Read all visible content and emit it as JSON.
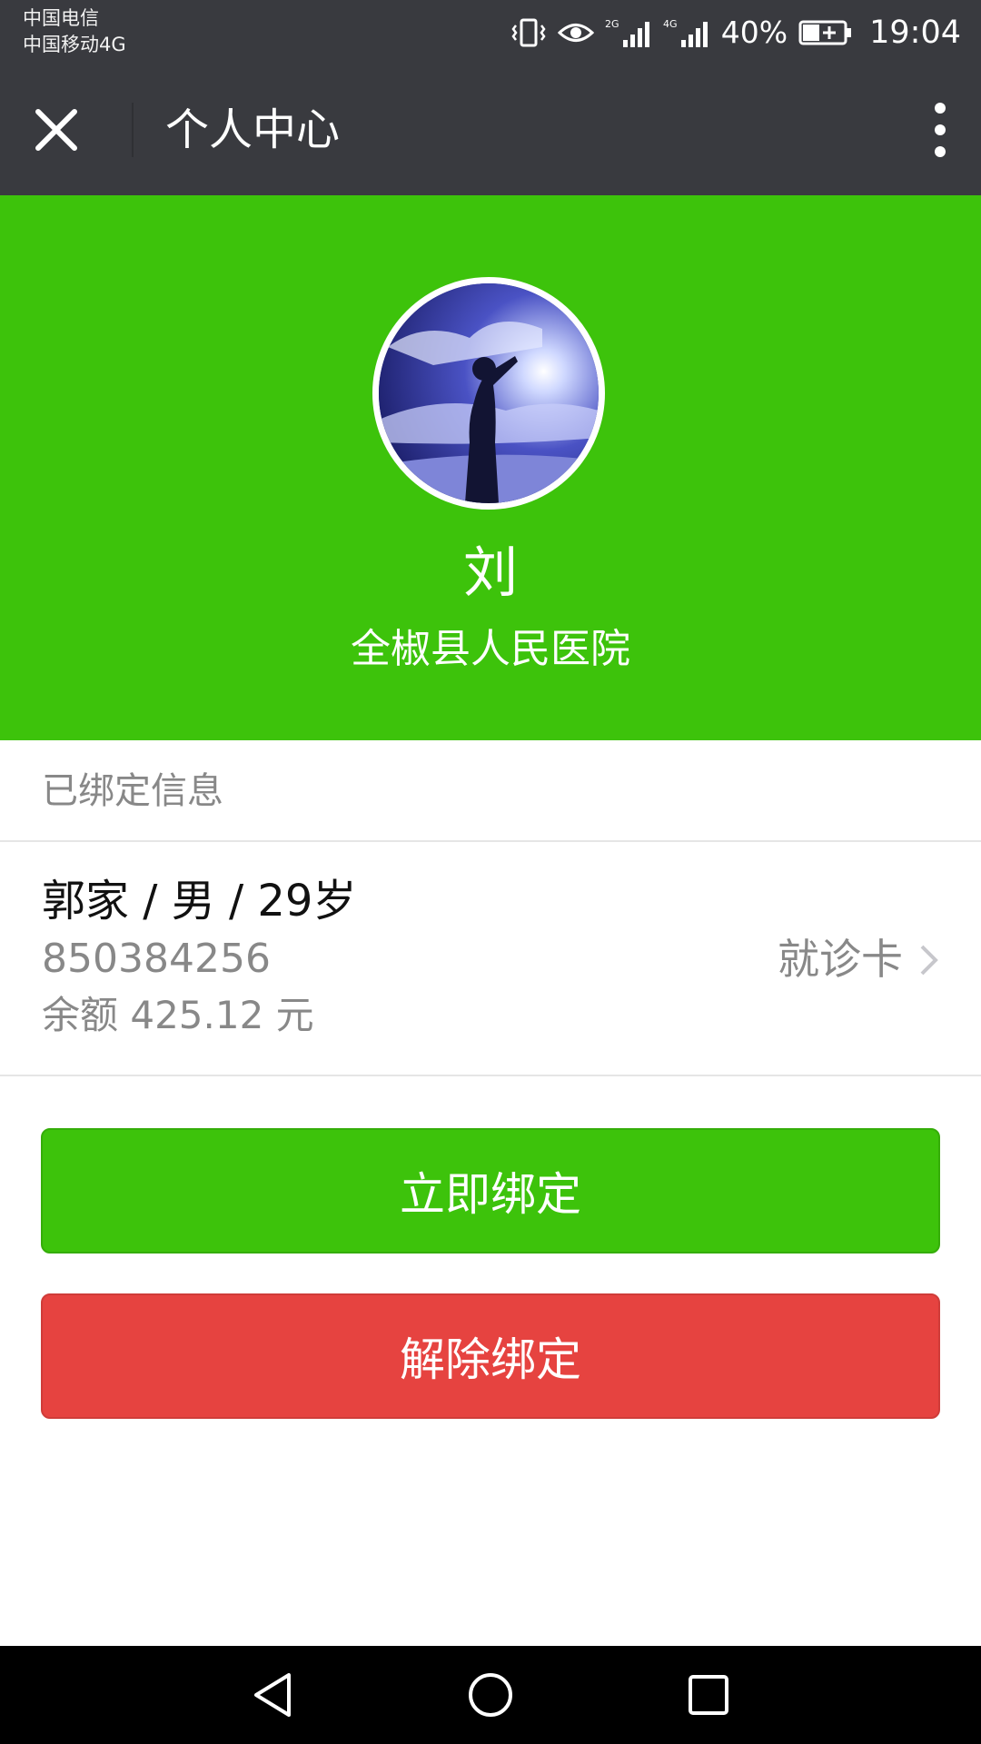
{
  "status_bar": {
    "carrier_1": "中国电信",
    "carrier_2": "中国移动4G",
    "signal_1_label": "2G",
    "signal_2_label": "4G",
    "battery": "40%",
    "time": "19:04"
  },
  "title_bar": {
    "title": "个人中心",
    "close_icon": "close-icon",
    "menu_icon": "more-vertical-icon"
  },
  "profile": {
    "name": "刘",
    "hospital": "全椒县人民医院",
    "avatar_icon": "avatar-photo"
  },
  "bound_info": {
    "section_title": "已绑定信息",
    "card": {
      "title": "郭家 / 男 / 29岁",
      "number": "850384256",
      "balance": "余额 425.12 元",
      "type": "就诊卡"
    }
  },
  "buttons": {
    "bind": "立即绑定",
    "unbind": "解除绑定"
  },
  "colors": {
    "dark_bar": "#393a3f",
    "green": "#3dc30b",
    "red": "#e64340",
    "gray_text": "#888888"
  }
}
